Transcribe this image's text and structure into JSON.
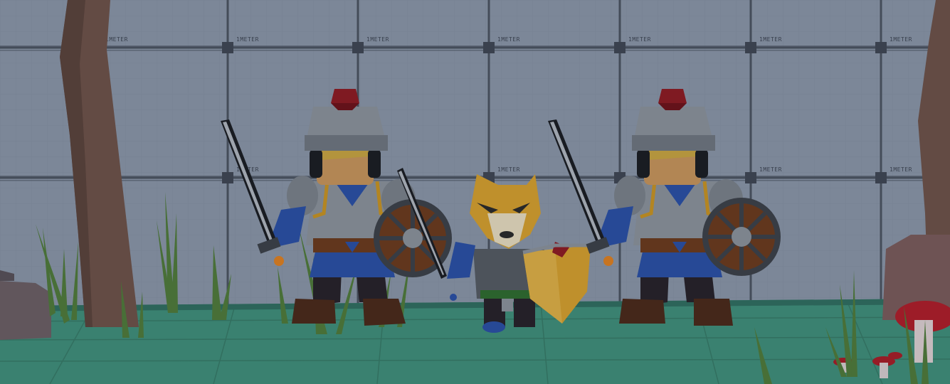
{
  "scene": {
    "type": "3d-game-viewport",
    "wall": {
      "grid_label": "1METER",
      "color": "#8a96a8",
      "grid_line_color": "#4a5260"
    },
    "floor": {
      "color": "#3f8f7a"
    },
    "characters": [
      {
        "name": "knight-left",
        "role": "knight",
        "weapons": [
          "sword",
          "round-shield"
        ],
        "helmet_plume_color": "#8e1a22"
      },
      {
        "name": "fox-warrior",
        "role": "fox",
        "weapons": [
          "sword",
          "kite-shield"
        ],
        "fur_color": "#d7a02d"
      },
      {
        "name": "knight-right",
        "role": "knight",
        "weapons": [
          "sword",
          "round-shield"
        ],
        "helmet_plume_color": "#8e1a22"
      }
    ],
    "props": [
      "tree-trunk-left",
      "tree-trunk-right",
      "grass-tufts",
      "rocks",
      "mushrooms"
    ],
    "colors": {
      "armor": "#8b929b",
      "tunic": "#2a4fa6",
      "trim": "#c99322",
      "skin": "#c8945b",
      "hair": "#c9a440",
      "shield_wood": "#6b3a1c",
      "shield_trim": "#3c4048",
      "trunk": "#6e5148",
      "mushroom": "#b01c28"
    }
  }
}
